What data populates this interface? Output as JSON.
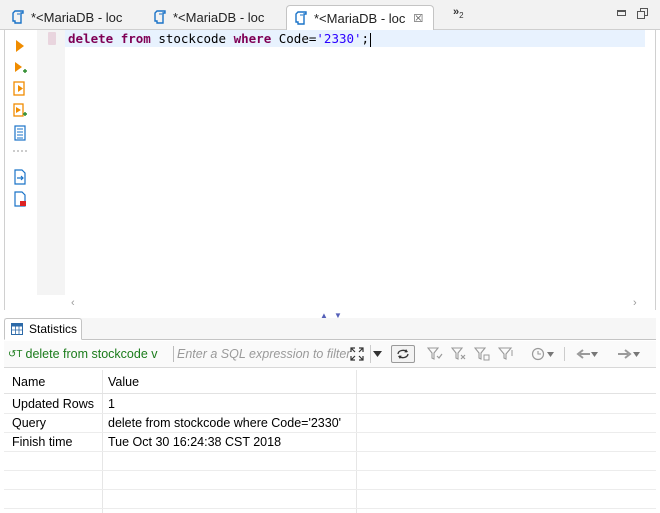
{
  "editor_tabs": [
    {
      "label": "*<MariaDB - loc",
      "active": false
    },
    {
      "label": "*<MariaDB - loc",
      "active": false
    },
    {
      "label": "*<MariaDB - loc",
      "active": true
    }
  ],
  "tab_overflow": {
    "label": "»",
    "count": "2"
  },
  "editor": {
    "tokens": {
      "kw1": "delete",
      "kw2": "from",
      "t1": " stockcode ",
      "kw3": "where",
      "t2": " Code=",
      "str": "'2330'",
      "t3": ";"
    }
  },
  "results": {
    "tab_label": "Statistics",
    "query_combo_text": "delete from stockcode v",
    "filter_placeholder": "Enter a SQL expression to filter results (use Ctrl+Space)",
    "columns": [
      "Name",
      "Value"
    ],
    "rows": [
      {
        "name": "Updated Rows",
        "value": "1"
      },
      {
        "name": "Query",
        "value": "delete from stockcode where Code='2330'"
      },
      {
        "name": "Finish time",
        "value": "Tue Oct 30 16:24:38 CST 2018"
      }
    ]
  },
  "colors": {
    "keyword": "#7f0055",
    "string": "#2a00ff",
    "current_line": "#e8f2fe",
    "query_text": "#1b7c1b",
    "icon_blue": "#1a73c8",
    "icon_orange": "#f08c00"
  }
}
